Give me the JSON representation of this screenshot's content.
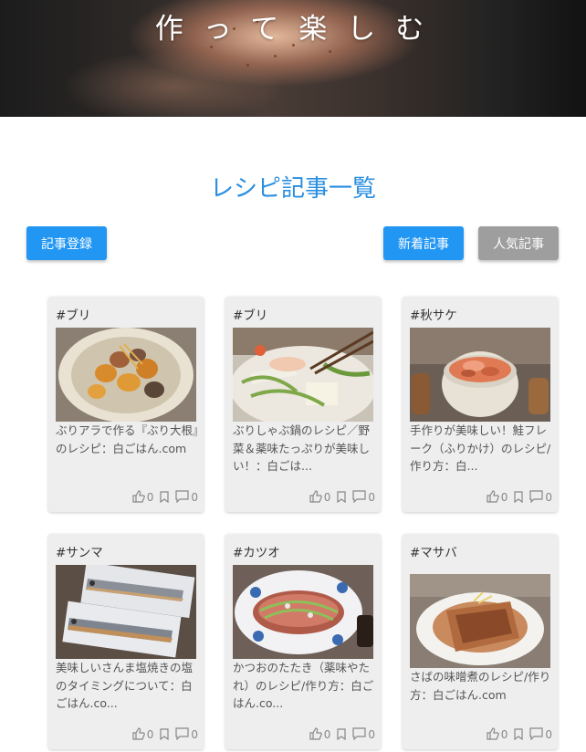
{
  "hero": {
    "title": "作って楽しむ"
  },
  "section": {
    "title": "レシピ記事一覧"
  },
  "buttons": {
    "register": "記事登録",
    "new": "新着記事",
    "popular": "人気記事"
  },
  "cards": [
    {
      "tag": "#ブリ",
      "title": "ぶりアラで作る『ぶり大根』のレシピ：白ごはん.com",
      "likes": "0",
      "comments": "0"
    },
    {
      "tag": "#ブリ",
      "title": "ぶりしゃぶ鍋のレシピ／野菜＆薬味たっぷりが美味しい！：白ごは...",
      "likes": "0",
      "comments": "0"
    },
    {
      "tag": "#秋サケ",
      "title": "手作りが美味しい！鮭フレーク（ふりかけ）のレシピ/作り方：白...",
      "likes": "0",
      "comments": "0"
    },
    {
      "tag": "#サンマ",
      "title": "美味しいさんま塩焼きの塩のタイミングについて：白ごはん.co...",
      "likes": "0",
      "comments": "0"
    },
    {
      "tag": "#カツオ",
      "title": "かつおのたたき（薬味やたれ）のレシピ/作り方：白ごはん.co...",
      "likes": "0",
      "comments": "0"
    },
    {
      "tag": "#マサバ",
      "title": "さばの味噌煮のレシピ/作り方：白ごはん.com",
      "likes": "0",
      "comments": "0"
    }
  ],
  "icons": {
    "like": "thumbs-up-icon",
    "bookmark": "bookmark-icon",
    "comment": "comment-icon"
  }
}
